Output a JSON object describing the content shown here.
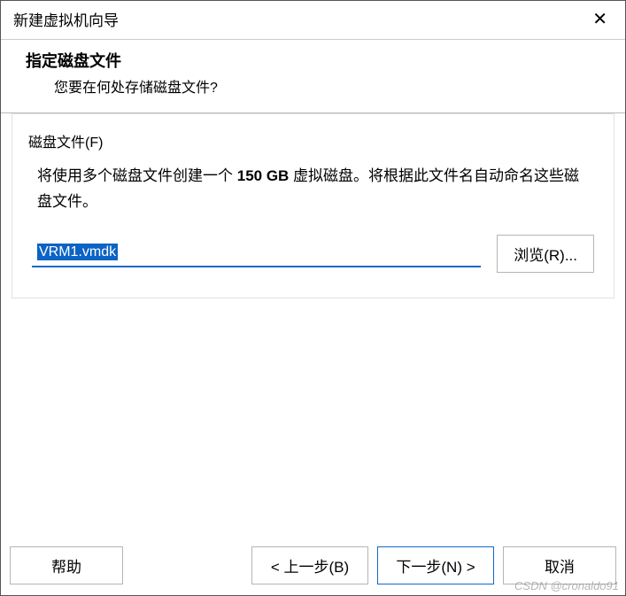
{
  "window": {
    "title": "新建虚拟机向导"
  },
  "header": {
    "heading": "指定磁盘文件",
    "sub": "您要在何处存储磁盘文件?"
  },
  "section": {
    "label": "磁盘文件(F)",
    "desc_prefix": "将使用多个磁盘文件创建一个 ",
    "disk_size": "150 GB",
    "desc_suffix": " 虚拟磁盘。将根据此文件名自动命名这些磁盘文件。",
    "file_value": "VRM1.vmdk",
    "browse": "浏览(R)..."
  },
  "buttons": {
    "help": "帮助",
    "back": "< 上一步(B)",
    "next": "下一步(N) >",
    "cancel": "取消"
  },
  "watermark": "CSDN @cronaldo91"
}
